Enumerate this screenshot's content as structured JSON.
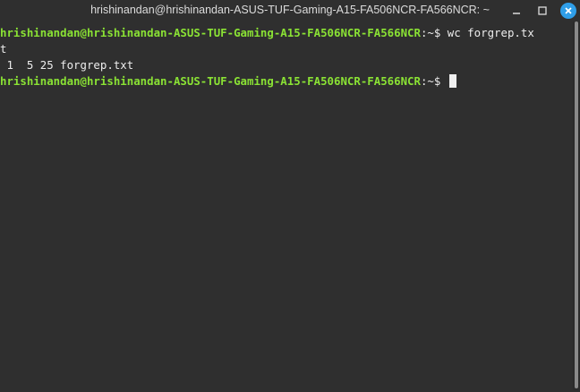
{
  "window": {
    "title": "hrishinandan@hrishinandan-ASUS-TUF-Gaming-A15-FA506NCR-FA566NCR: ~",
    "controls": {
      "minimize_icon": "minimize-icon",
      "maximize_icon": "maximize-icon",
      "close_icon": "close-icon",
      "close_color": "#2f9ee8"
    }
  },
  "terminal": {
    "prompt_color": "#8ae234",
    "lines": [
      {
        "prompt": "hrishinandan@hrishinandan-ASUS-TUF-Gaming-A15-FA506NCR-FA566NCR",
        "suffix": ":~$ wc forgrep.tx"
      },
      {
        "text": "t"
      },
      {
        "text": " 1  5 25 forgrep.txt"
      },
      {
        "prompt": "hrishinandan@hrishinandan-ASUS-TUF-Gaming-A15-FA506NCR-FA566NCR",
        "suffix": ":~$ "
      }
    ]
  }
}
